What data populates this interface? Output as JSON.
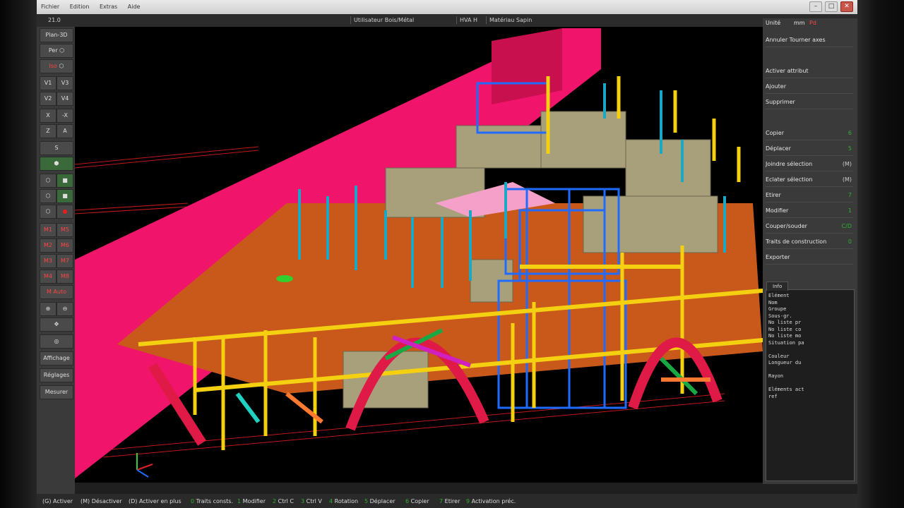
{
  "window": {
    "menu": [
      "Fichier",
      "Edition",
      "Extras",
      "Aide"
    ],
    "version": "21.0",
    "fields": [
      {
        "label": "Utilisateur",
        "value": "Bois/Métal"
      },
      {
        "label": "HVA",
        "value": "H"
      },
      {
        "label": "Matériau",
        "value": "Sapin"
      }
    ]
  },
  "left_toolbar": {
    "plan3d": "Plan-3D",
    "per": "Per",
    "iso": "Iso",
    "v1": "V1",
    "v3": "V3",
    "v2": "V2",
    "v4": "V4",
    "x": "X",
    "xneg": "-X",
    "z": "Z",
    "a": "A",
    "s": "S",
    "m1": "M1",
    "m5": "M5",
    "m2": "M2",
    "m6": "M6",
    "m3": "M3",
    "m7": "M7",
    "m4": "M4",
    "m8": "M8",
    "mauto": "M Auto",
    "affichage": "Affichage",
    "reglages": "Réglages",
    "mesurer": "Mesurer"
  },
  "right_panel": {
    "unit_label": "Unité",
    "unit_mm": "mm",
    "unit_pied": "Pd",
    "undo_axes": "Annuler Tourner axes",
    "items": [
      {
        "label": "Activer attribut",
        "shortcut": ""
      },
      {
        "label": "Ajouter",
        "shortcut": ""
      },
      {
        "label": "Supprimer",
        "shortcut": ""
      },
      {
        "label": "Copier",
        "shortcut": "6"
      },
      {
        "label": "Déplacer",
        "shortcut": "5"
      },
      {
        "label": "Joindre sélection",
        "shortcut": "(M)"
      },
      {
        "label": "Eclater sélection",
        "shortcut": "(M)"
      },
      {
        "label": "Etirer",
        "shortcut": "7"
      },
      {
        "label": "Modifier",
        "shortcut": "1"
      },
      {
        "label": "Couper/souder",
        "shortcut": "C/D"
      },
      {
        "label": "Traits de construction",
        "shortcut": "0"
      },
      {
        "label": "Exporter",
        "shortcut": ""
      }
    ],
    "info": {
      "tab": "Info",
      "lines": [
        "Elément",
        "Nom",
        "Groupe",
        "Sous-gr.",
        "No liste pr",
        "No liste co",
        "No liste mo",
        "Situation pa",
        "",
        "Couleur",
        "Longueur du",
        "",
        "Rayon",
        "",
        "Eléments act",
        "ref"
      ]
    }
  },
  "statusbar": [
    {
      "key": "(G)",
      "label": "Activer"
    },
    {
      "key": "(M)",
      "label": "Désactiver"
    },
    {
      "key": "(D)",
      "label": "Activer en plus"
    },
    {
      "key": "0",
      "label": "Traits consts."
    },
    {
      "key": "1",
      "label": "Modifier"
    },
    {
      "key": "2",
      "label": "Ctrl C"
    },
    {
      "key": "3",
      "label": "Ctrl V"
    },
    {
      "key": "4",
      "label": "Rotation"
    },
    {
      "key": "5",
      "label": "Déplacer"
    },
    {
      "key": "6",
      "label": "Copier"
    },
    {
      "key": "7",
      "label": "Etirer"
    },
    {
      "key": "9",
      "label": "Activation préc."
    }
  ],
  "colors": {
    "wall_pink": "#f0156a",
    "floor_orange": "#c8591a",
    "beam_yellow": "#f4d010",
    "post_cyan": "#1aa8c4",
    "frame_blue": "#1f6bff",
    "walls_olive": "#a8a07a",
    "arch_red": "#e01a46",
    "accent_green": "#2fb02f",
    "accent_red": "#ff4444"
  }
}
